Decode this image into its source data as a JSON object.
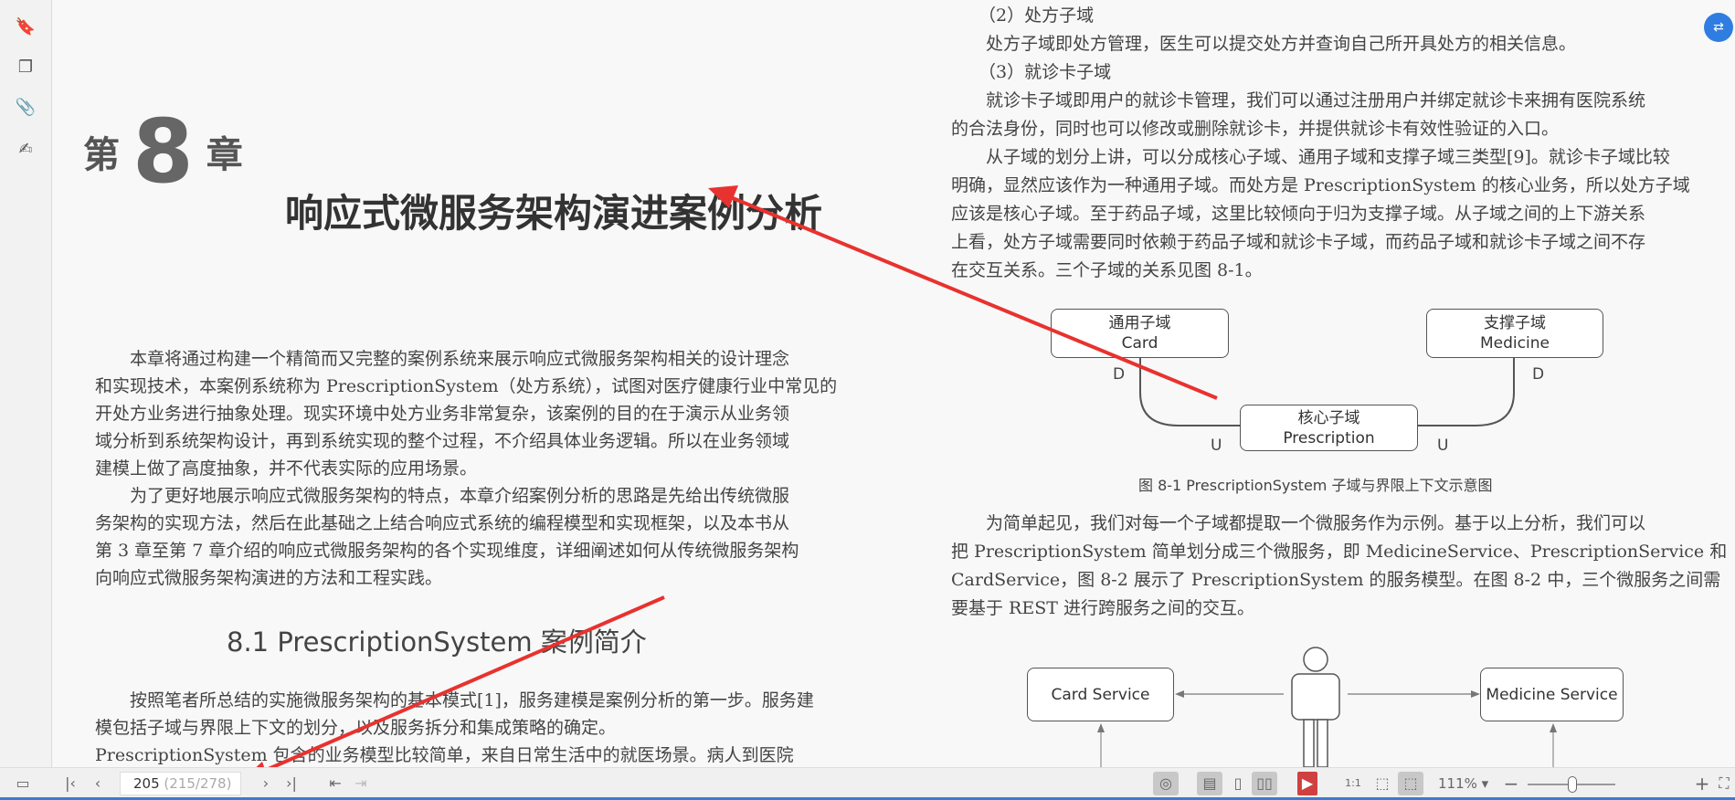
{
  "sidebar": {
    "items": [
      {
        "icon": "bookmark-icon",
        "glyph": "🔖"
      },
      {
        "icon": "pages-icon",
        "glyph": "❐"
      },
      {
        "icon": "attachment-icon",
        "glyph": "📎"
      },
      {
        "icon": "signature-icon",
        "glyph": "✍"
      }
    ]
  },
  "left_page": {
    "chapter_prefix": "第",
    "chapter_number": "8",
    "chapter_suffix": "章",
    "title": "响应式微服务架构演进案例分析",
    "intro": [
      "本章将通过构建一个精简而又完整的案例系统来展示响应式微服务架构相关的设计理念",
      "和实现技术，本案例系统称为 PrescriptionSystem（处方系统），试图对医疗健康行业中常见的",
      "开处方业务进行抽象处理。现实环境中处方业务非常复杂，该案例的目的在于演示从业务领",
      "域分析到系统架构设计，再到系统实现的整个过程，不介绍具体业务逻辑。所以在业务领域",
      "建模上做了高度抽象，并不代表实际的应用场景。",
      "为了更好地展示响应式微服务架构的特点，本章介绍案例分析的思路是先给出传统微服",
      "务架构的实现方法，然后在此基础之上结合响应式系统的编程模型和实现框架，以及本书从",
      "第 3 章至第 7 章介绍的响应式微服务架构的各个实现维度，详细阐述如何从传统微服务架构",
      "向响应式微服务架构演进的方法和工程实践。"
    ],
    "section_heading": "8.1    PrescriptionSystem 案例简介",
    "section_text": [
      "按照笔者所总结的实施微服务架构的基本模式[1]，服务建模是案例分析的第一步。服务建",
      "模包括子域与界限上下文的划分，以及服务拆分和集成策略的确定。",
      "PrescriptionSystem 包含的业务模型比较简单，来自日常生活中的就医场景。病人到医院"
    ]
  },
  "right_page": {
    "lines": [
      "（2）处方子域",
      "处方子域即处方管理，医生可以提交处方并查询自己所开具处方的相关信息。",
      "（3）就诊卡子域",
      "就诊卡子域即用户的就诊卡管理，我们可以通过注册用户并绑定就诊卡来拥有医院系统",
      "的合法身份，同时也可以修改或删除就诊卡，并提供就诊卡有效性验证的入口。",
      "从子域的划分上讲，可以分成核心子域、通用子域和支撑子域三类型[9]。就诊卡子域比较",
      "明确，显然应该作为一种通用子域。而处方是 PrescriptionSystem 的核心业务，所以处方子域",
      "应该是核心子域。至于药品子域，这里比较倾向于归为支撑子域。从子域之间的上下游关系",
      "上看，处方子域需要同时依赖于药品子域和就诊卡子域，而药品子域和就诊卡子域之间不存",
      "在交互关系。三个子域的关系见图 8-1。"
    ],
    "figure1": {
      "generic": {
        "line1": "通用子域",
        "line2": "Card"
      },
      "supporting": {
        "line1": "支撑子域",
        "line2": "Medicine"
      },
      "core": {
        "line1": "核心子域",
        "line2": "Prescription"
      },
      "label_d": "D",
      "label_u": "U",
      "caption": "图 8-1    PrescriptionSystem 子域与界限上下文示意图"
    },
    "para2": [
      "为简单起见，我们对每一个子域都提取一个微服务作为示例。基于以上分析，我们可以",
      "把 PrescriptionSystem 简单划分成三个微服务，即 MedicineService、PrescriptionService 和",
      "CardService，图 8-2 展示了 PrescriptionSystem 的服务模型。在图 8-2 中，三个微服务之间需",
      "要基于 REST 进行跨服务之间的交互。"
    ],
    "figure2": {
      "card_service": "Card Service",
      "medicine_service": "Medicine Service"
    }
  },
  "fab": {
    "icon": "translate-icon",
    "glyph": "⇄"
  },
  "toolbar": {
    "current_page": "205",
    "page_total": "(215/278)",
    "zoom": "111%",
    "zoom_slider_percent": 50,
    "annotation_color": "#e8322f",
    "accent": "#2f7de1"
  }
}
